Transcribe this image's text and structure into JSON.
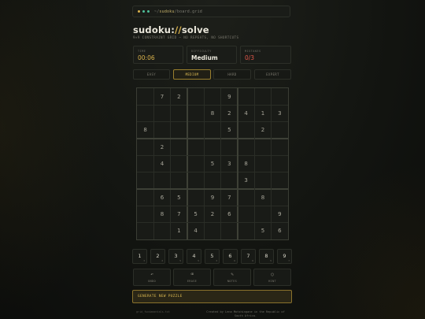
{
  "path": {
    "prefix": "~/",
    "folder": "sudoku",
    "file": "/board.grid"
  },
  "title": {
    "main": "sudoku:",
    "accent": "//",
    "suffix": "solve"
  },
  "subtitle": "9×9 CONSTRAINT GRID — NO REPEATS, NO SHORTCUTS",
  "stats": {
    "time": {
      "label": "TIME",
      "value": "00:06"
    },
    "difficulty": {
      "label": "DIFFICULTY",
      "value": "Medium"
    },
    "mistakes": {
      "label": "MISTAKES",
      "value": "0/3"
    }
  },
  "difficulty_options": [
    "EASY",
    "MEDIUM",
    "HARD",
    "EXPERT"
  ],
  "difficulty_selected": "MEDIUM",
  "grid": [
    [
      "",
      "7",
      "2",
      "",
      "",
      "9",
      "",
      "",
      ""
    ],
    [
      "",
      "",
      "",
      "",
      "8",
      "2",
      "4",
      "1",
      "3"
    ],
    [
      "8",
      "",
      "",
      "",
      "",
      "5",
      "",
      "2",
      ""
    ],
    [
      "",
      "2",
      "",
      "",
      "",
      "",
      "",
      "",
      ""
    ],
    [
      "",
      "4",
      "",
      "",
      "5",
      "3",
      "8",
      "",
      ""
    ],
    [
      "",
      "",
      "",
      "",
      "",
      "",
      "3",
      "",
      ""
    ],
    [
      "",
      "6",
      "5",
      "",
      "9",
      "7",
      "",
      "8",
      ""
    ],
    [
      "",
      "8",
      "7",
      "5",
      "2",
      "6",
      "",
      "",
      "9"
    ],
    [
      "",
      "",
      "1",
      "4",
      "",
      "",
      "",
      "5",
      "6"
    ]
  ],
  "numpad": [
    {
      "n": "1",
      "c": "3"
    },
    {
      "n": "2",
      "c": "2"
    },
    {
      "n": "3",
      "c": "5"
    },
    {
      "n": "4",
      "c": "5"
    },
    {
      "n": "5",
      "c": "3"
    },
    {
      "n": "6",
      "c": "6"
    },
    {
      "n": "7",
      "c": "6"
    },
    {
      "n": "8",
      "c": "5"
    },
    {
      "n": "9",
      "c": "7"
    }
  ],
  "actions": [
    {
      "label": "UNDO",
      "icon": "undo-icon",
      "glyph": "↶"
    },
    {
      "label": "ERASE",
      "icon": "eraser-icon",
      "glyph": "⌫"
    },
    {
      "label": "NOTES",
      "icon": "pencil-icon",
      "glyph": "✎"
    },
    {
      "label": "HINT",
      "icon": "lightbulb-icon",
      "glyph": "○"
    }
  ],
  "generate_label": "GENERATE NEW PUZZLE",
  "footer": {
    "left": "grid_fundamentals.txt",
    "right": "Created by Lena Motshingane in the Republic of South Africa."
  },
  "colors": {
    "accent": "#d9b24c",
    "time": "#d9b24c",
    "mistakes": "#e0574a",
    "dot1": "#d9b24c",
    "dot2": "#4fbf9a",
    "dot3": "#4fbf9a"
  }
}
